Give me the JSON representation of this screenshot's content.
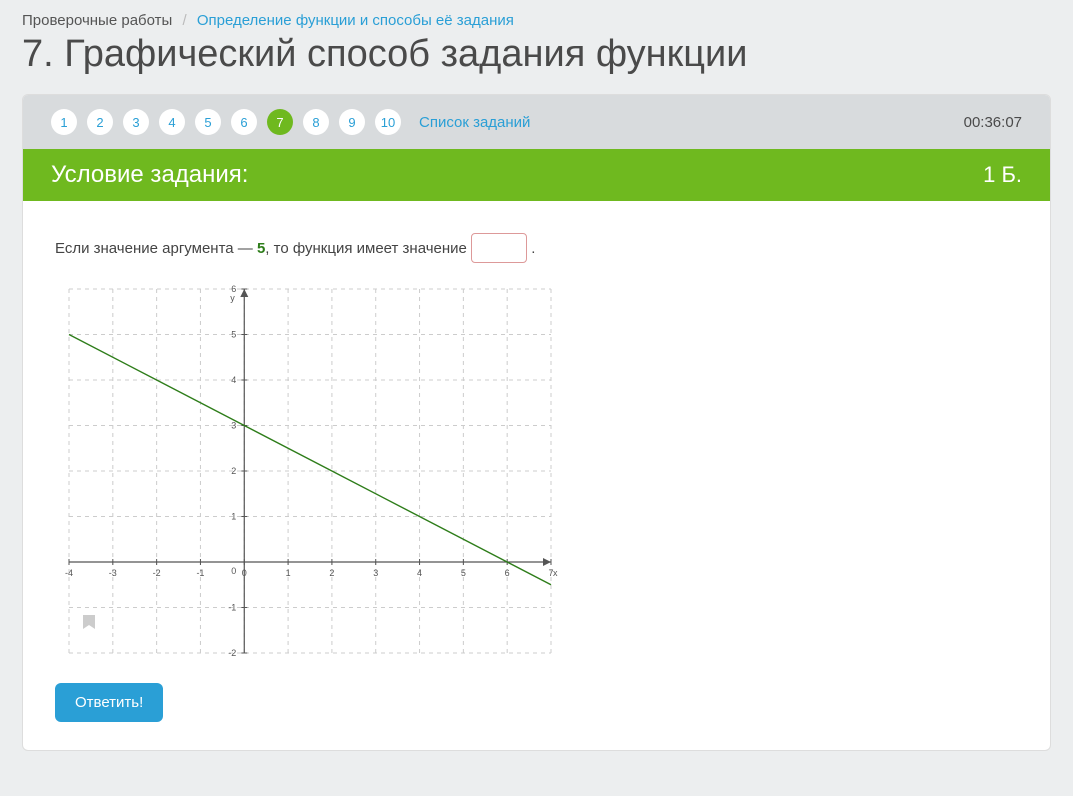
{
  "breadcrumb": {
    "parent": "Проверочные работы",
    "current": "Определение функции и способы её задания"
  },
  "title": "7. Графический способ задания функции",
  "question_nav": {
    "items": [
      "1",
      "2",
      "3",
      "4",
      "5",
      "6",
      "7",
      "8",
      "9",
      "10"
    ],
    "active_index": 6,
    "list_label": "Список заданий"
  },
  "timer": "00:36:07",
  "condition": {
    "label": "Условие задания:",
    "points": "1 Б."
  },
  "prompt": {
    "before_arg": "Если значение аргумента — ",
    "arg": "5",
    "after_arg": ", то функция имеет значение ",
    "period": "."
  },
  "answer_value": "",
  "submit_label": "Ответить!",
  "chart_data": {
    "type": "line",
    "title": "",
    "xlabel": "x",
    "ylabel": "y",
    "xlim": [
      -4,
      7
    ],
    "ylim": [
      -2,
      6
    ],
    "x_ticks": [
      -4,
      -3,
      -2,
      -1,
      0,
      1,
      2,
      3,
      4,
      5,
      6,
      7
    ],
    "y_ticks": [
      -2,
      -1,
      0,
      1,
      2,
      3,
      4,
      5,
      6
    ],
    "grid": true,
    "series": [
      {
        "name": "linear",
        "color": "#2e7d1a",
        "points": [
          {
            "x": -4,
            "y": 5
          },
          {
            "x": -2,
            "y": 4
          },
          {
            "x": 0,
            "y": 3
          },
          {
            "x": 2,
            "y": 2
          },
          {
            "x": 4,
            "y": 1
          },
          {
            "x": 5,
            "y": 0.5
          },
          {
            "x": 6,
            "y": 0
          },
          {
            "x": 7,
            "y": -0.5
          }
        ]
      }
    ]
  }
}
